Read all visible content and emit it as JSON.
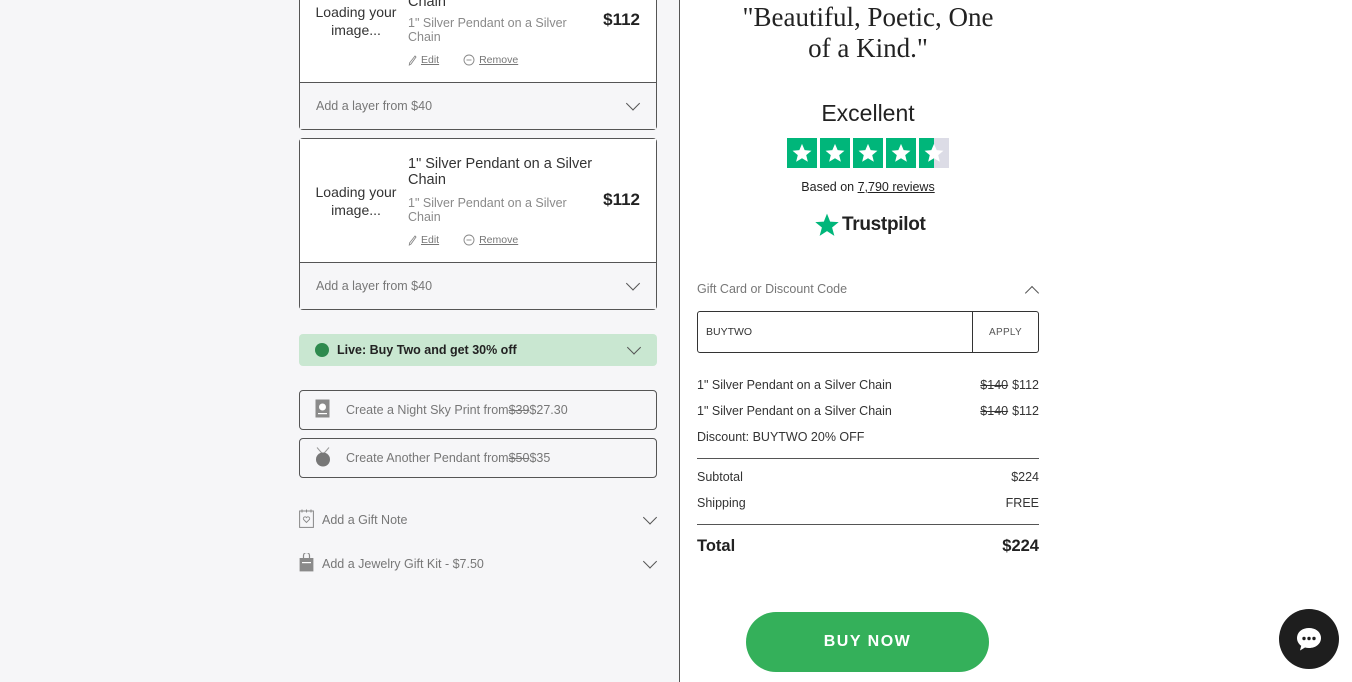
{
  "cart": {
    "items": [
      {
        "image_loading": "Loading your image...",
        "title": "Chain",
        "subtitle": "1\" Silver Pendant on a Silver Chain",
        "price": "$112",
        "edit_label": "Edit",
        "remove_label": "Remove",
        "layer_label": "Add a layer from $40"
      },
      {
        "image_loading": "Loading your image...",
        "title": "1\" Silver Pendant on a Silver Chain",
        "subtitle": "1\" Silver Pendant on a Silver Chain",
        "price": "$112",
        "edit_label": "Edit",
        "remove_label": "Remove",
        "layer_label": "Add a layer from $40"
      }
    ],
    "promo_banner": "Live: Buy Two and get 30% off",
    "upsells": [
      {
        "prefix": "Create a Night Sky Print from ",
        "old_price": "$39",
        "new_price": " $27.30",
        "icon": "print-icon"
      },
      {
        "prefix": "Create Another Pendant from ",
        "old_price": "$50",
        "new_price": " $35",
        "icon": "pendant-icon"
      }
    ],
    "options": [
      {
        "label": "Add a Gift Note",
        "icon": "gift-note-icon"
      },
      {
        "label": "Add a Jewelry Gift Kit - $7.50",
        "icon": "gift-bag-icon"
      }
    ]
  },
  "sidebar": {
    "quote": "\"Beautiful, Poetic, One of a Kind.\"",
    "trustpilot": {
      "rating_word": "Excellent",
      "stars": 4.5,
      "based_on": "Based on ",
      "review_count": "7,790 reviews",
      "logo_text": "Trustpilot",
      "star_color": "#00b67a"
    },
    "discount": {
      "header": "Gift Card or Discount Code",
      "input_value": "BUYTWO",
      "apply_label": "APPLY"
    },
    "line_items": [
      {
        "name": "1\" Silver Pendant on a Silver Chain",
        "old_price": "$140",
        "price": "$112"
      },
      {
        "name": "1\" Silver Pendant on a Silver Chain",
        "old_price": "$140",
        "price": "$112"
      }
    ],
    "discount_line": "Discount: BUYTWO 20% OFF",
    "subtotal_label": "Subtotal",
    "subtotal_value": "$224",
    "shipping_label": "Shipping",
    "shipping_value": "FREE",
    "total_label": "Total",
    "total_value": "$224",
    "buy_now_label": "BUY NOW",
    "accent_color": "#34b05a"
  }
}
